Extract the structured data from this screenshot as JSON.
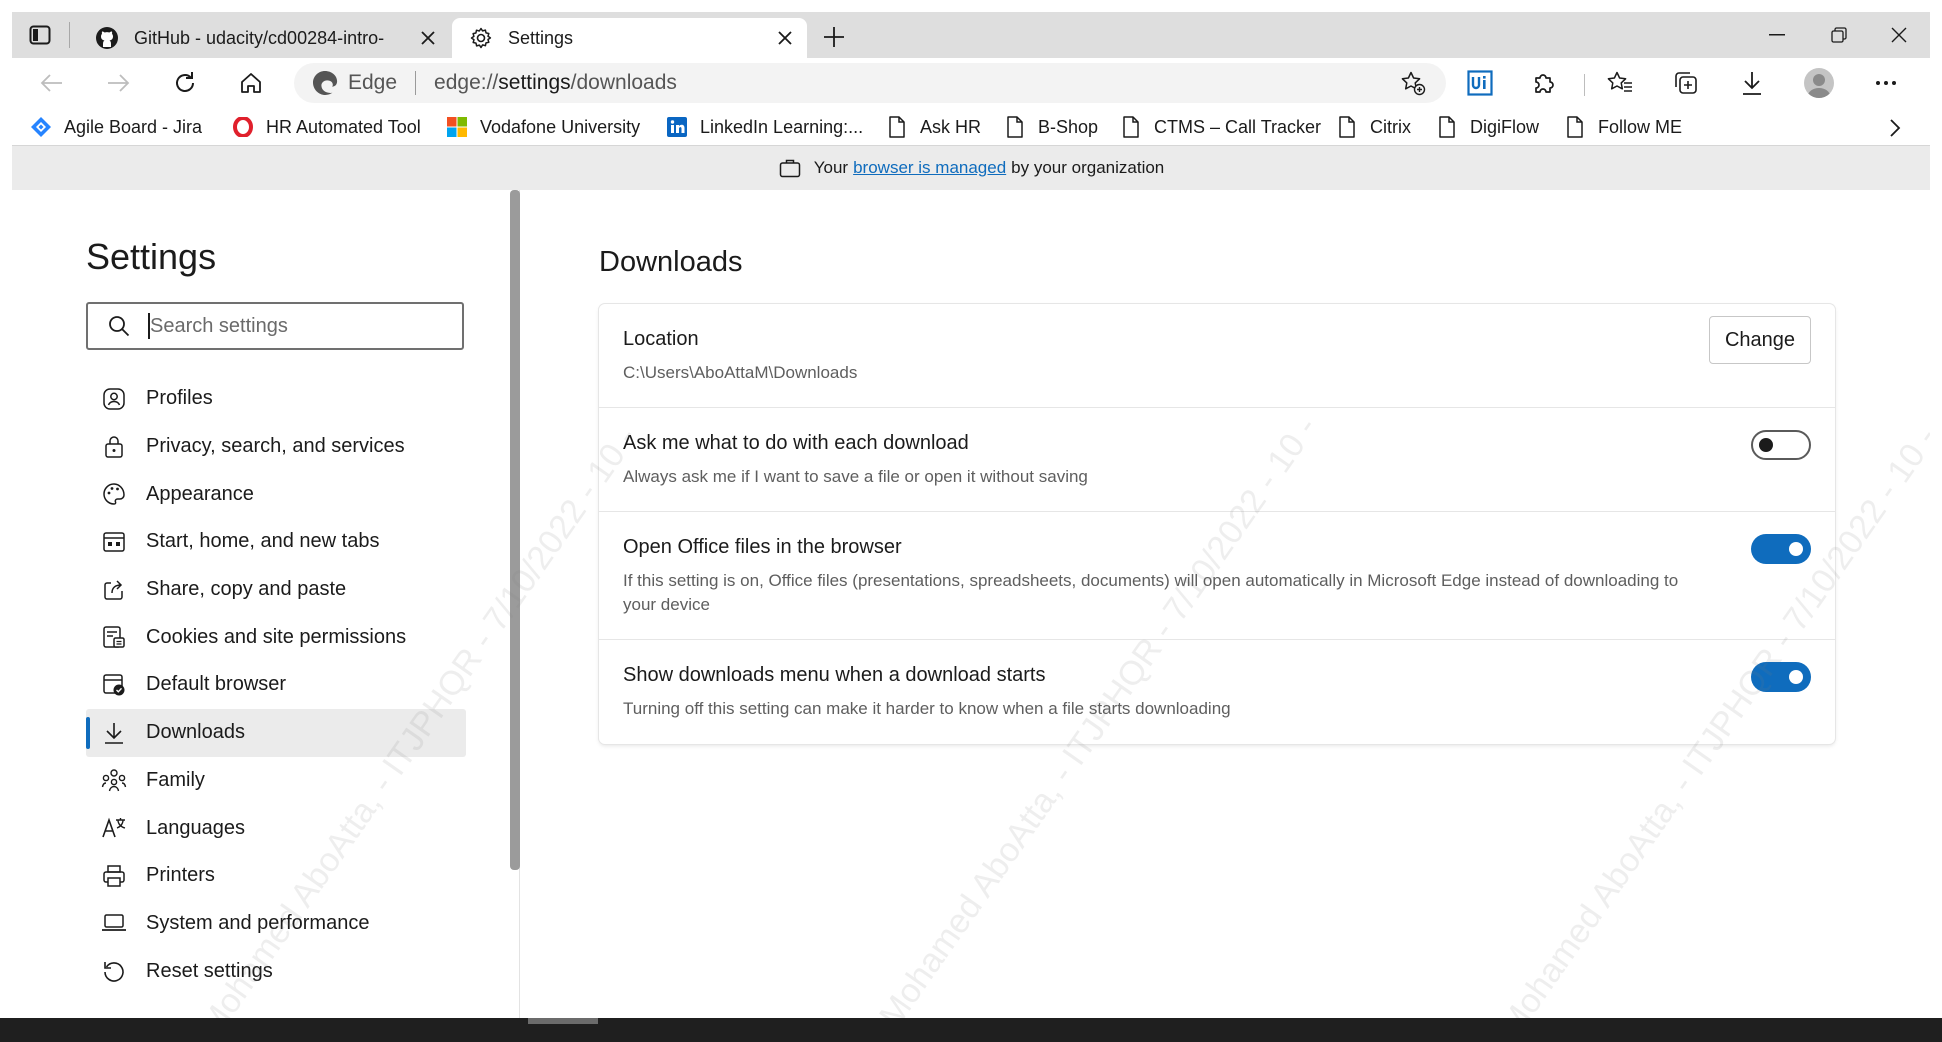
{
  "tabs": [
    {
      "title": "GitHub - udacity/cd00284-intro-",
      "icon": "github-icon",
      "active": false
    },
    {
      "title": "Settings",
      "icon": "gear-icon",
      "active": true
    }
  ],
  "toolbar": {
    "brand": "Edge",
    "url_prefix": "edge://",
    "url_host": "settings",
    "url_path": "/downloads"
  },
  "favorites": [
    {
      "label": "Agile Board - Jira",
      "icon": "jira-icon"
    },
    {
      "label": "HR Automated Tool",
      "icon": "opera-icon"
    },
    {
      "label": "Vodafone University",
      "icon": "microsoft-icon"
    },
    {
      "label": "LinkedIn Learning:...",
      "icon": "linkedin-icon"
    },
    {
      "label": "Ask HR",
      "icon": "page-icon"
    },
    {
      "label": "B-Shop",
      "icon": "page-icon"
    },
    {
      "label": "CTMS – Call Tracker",
      "icon": "page-icon"
    },
    {
      "label": "Citrix",
      "icon": "page-icon"
    },
    {
      "label": "DigiFlow",
      "icon": "page-icon"
    },
    {
      "label": "Follow ME",
      "icon": "page-icon"
    }
  ],
  "managed": {
    "prefix": "Your",
    "link": "browser is managed",
    "suffix": "by your organization"
  },
  "sidebar": {
    "title": "Settings",
    "search_placeholder": "Search settings",
    "items": [
      {
        "label": "Profiles",
        "icon": "profile-icon"
      },
      {
        "label": "Privacy, search, and services",
        "icon": "lock-icon"
      },
      {
        "label": "Appearance",
        "icon": "palette-icon"
      },
      {
        "label": "Start, home, and new tabs",
        "icon": "start-tabs-icon"
      },
      {
        "label": "Share, copy and paste",
        "icon": "share-icon"
      },
      {
        "label": "Cookies and site permissions",
        "icon": "cookies-icon"
      },
      {
        "label": "Default browser",
        "icon": "default-browser-icon"
      },
      {
        "label": "Downloads",
        "icon": "download-icon"
      },
      {
        "label": "Family",
        "icon": "family-icon"
      },
      {
        "label": "Languages",
        "icon": "languages-icon"
      },
      {
        "label": "Printers",
        "icon": "printer-icon"
      },
      {
        "label": "System and performance",
        "icon": "laptop-icon"
      },
      {
        "label": "Reset settings",
        "icon": "reset-icon"
      }
    ],
    "active_index": 7
  },
  "main": {
    "title": "Downloads",
    "location": {
      "title": "Location",
      "path": "C:\\Users\\AboAttaM\\Downloads",
      "button": "Change"
    },
    "settings": [
      {
        "title": "Ask me what to do with each download",
        "desc": "Always ask me if I want to save a file or open it without saving",
        "enabled": false
      },
      {
        "title": "Open Office files in the browser",
        "desc": "If this setting is on, Office files (presentations, spreadsheets, documents) will open automatically in Microsoft Edge instead of downloading to your device",
        "enabled": true
      },
      {
        "title": "Show downloads menu when a download starts",
        "desc": "Turning off this setting can make it harder to know when a file starts downloading",
        "enabled": true
      }
    ]
  },
  "watermark": "Mohamed AboAtta, - ITJPHQR - 7/10/2022 - 10 -",
  "colors": {
    "accent": "#0f6cbd",
    "tabstrip": "#dedede",
    "banner": "#ebebeb"
  }
}
